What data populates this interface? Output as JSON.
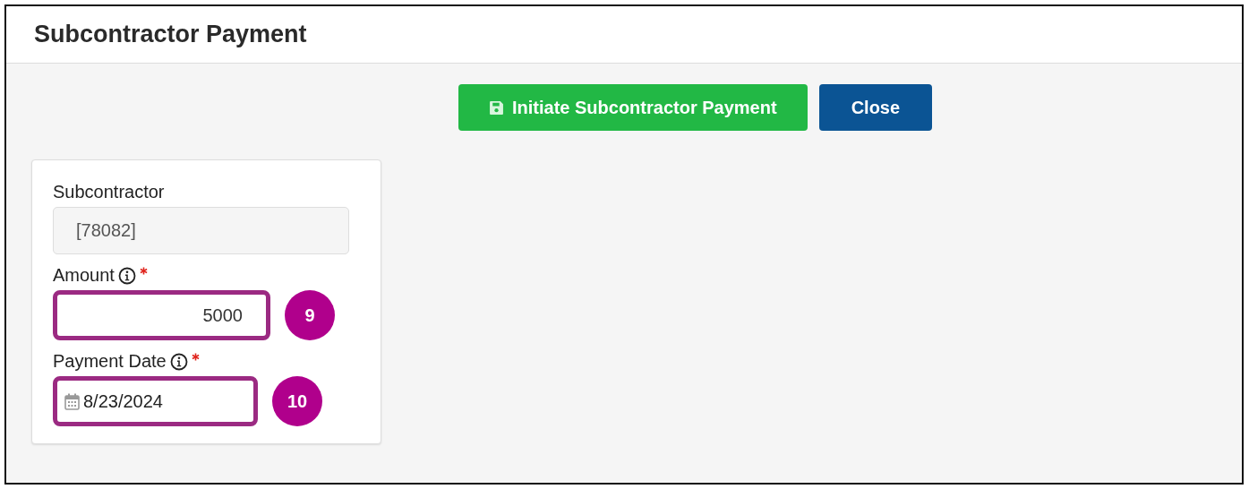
{
  "window": {
    "title": "Subcontractor Payment"
  },
  "actions": [
    {
      "label": "Initiate Subcontractor Payment",
      "kind": "save"
    },
    {
      "label": "Close",
      "kind": "close"
    }
  ],
  "fields": [
    {
      "label": "Subcontractor",
      "kind": "text",
      "value": "[78082]",
      "disabled": true,
      "required": false,
      "info": false
    },
    {
      "label": "Amount",
      "kind": "number",
      "value": "5000",
      "disabled": false,
      "required": true,
      "info": true,
      "callout": "9"
    },
    {
      "label": "Payment Date",
      "kind": "date",
      "value": "8/23/2024",
      "disabled": false,
      "required": true,
      "info": true,
      "callout": "10"
    }
  ]
}
